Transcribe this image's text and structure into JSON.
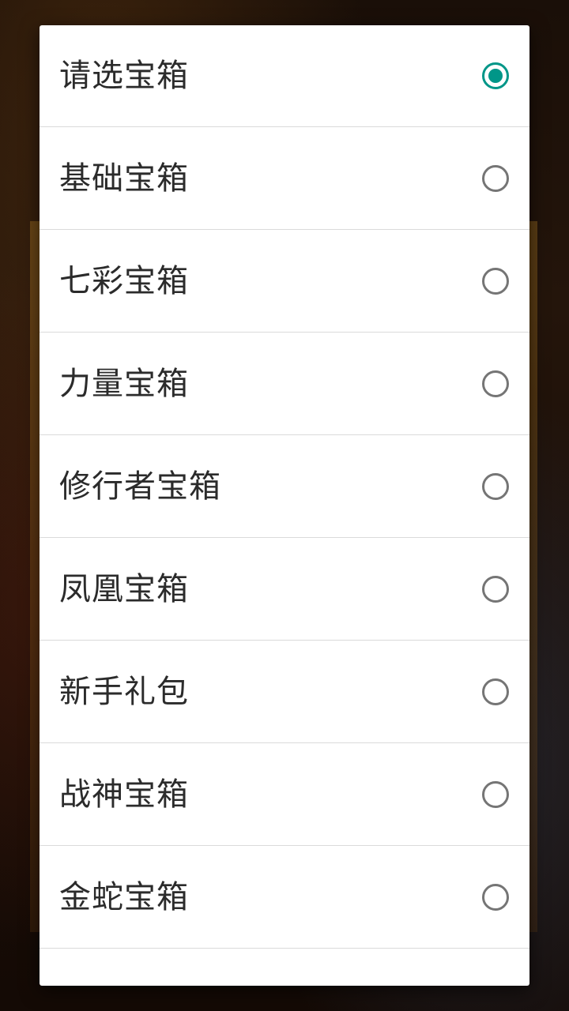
{
  "dialog": {
    "options": [
      {
        "label": "请选宝箱",
        "selected": true
      },
      {
        "label": "基础宝箱",
        "selected": false
      },
      {
        "label": "七彩宝箱",
        "selected": false
      },
      {
        "label": "力量宝箱",
        "selected": false
      },
      {
        "label": "修行者宝箱",
        "selected": false
      },
      {
        "label": "凤凰宝箱",
        "selected": false
      },
      {
        "label": "新手礼包",
        "selected": false
      },
      {
        "label": "战神宝箱",
        "selected": false
      },
      {
        "label": "金蛇宝箱",
        "selected": false
      }
    ],
    "accent_color": "#009688",
    "radio_icon": "radio-button-icon"
  }
}
